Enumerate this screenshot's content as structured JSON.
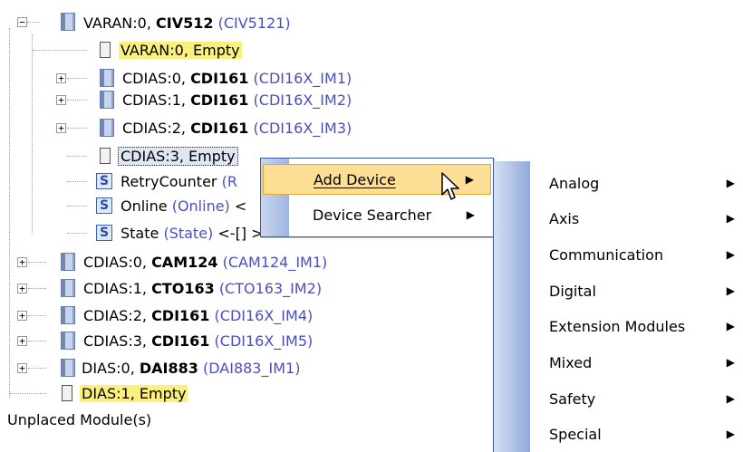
{
  "tree": {
    "varan_root": {
      "prefix": "VARAN:0, ",
      "name": "CIV512",
      "type": "(CIV5121)"
    },
    "varan_empty": "VARAN:0, Empty",
    "cdias0": {
      "prefix": "CDIAS:0, ",
      "name": "CDI161",
      "type": "(CDI16X_IM1)"
    },
    "cdias1": {
      "prefix": "CDIAS:1, ",
      "name": "CDI161",
      "type": "(CDI16X_IM2)"
    },
    "cdias2": {
      "prefix": "CDIAS:2, ",
      "name": "CDI161",
      "type": "(CDI16X_IM3)"
    },
    "cdias3_empty": "CDIAS:3, Empty",
    "retry": {
      "name": "RetryCounter",
      "type": "(R"
    },
    "online": {
      "name": "Online",
      "type": "(Online)",
      "tail": "<"
    },
    "state": {
      "name": "State",
      "type": "(State)",
      "tail": "<-[] >"
    },
    "s_label": "S",
    "cdias0b": {
      "prefix": "CDIAS:0, ",
      "name": "CAM124",
      "type": "(CAM124_IM1)"
    },
    "cdias1b": {
      "prefix": "CDIAS:1, ",
      "name": "CTO163",
      "type": "(CTO163_IM2)"
    },
    "cdias2b": {
      "prefix": "CDIAS:2, ",
      "name": "CDI161",
      "type": "(CDI16X_IM4)"
    },
    "cdias3b": {
      "prefix": "CDIAS:3, ",
      "name": "CDI161",
      "type": "(CDI16X_IM5)"
    },
    "dias0": {
      "prefix": "DIAS:0, ",
      "name": "DAI883",
      "type": "(DAI883_IM1)"
    },
    "dias1_empty": "DIAS:1, Empty",
    "unplaced": "Unplaced Module(s)",
    "expand_plus": "+",
    "collapse_minus": "−"
  },
  "context_menu": {
    "add_device": "Add Device",
    "device_searcher": "Device Searcher",
    "arrow": "▶"
  },
  "submenu": {
    "items": [
      "Analog",
      "Axis",
      "Communication",
      "Digital",
      "Extension Modules",
      "Mixed",
      "Safety",
      "Special"
    ],
    "arrow": "▶"
  },
  "colors": {
    "highlight": "#fbf07b",
    "type_text": "#4a4fc0",
    "menu_hot": "#fcdf95"
  }
}
